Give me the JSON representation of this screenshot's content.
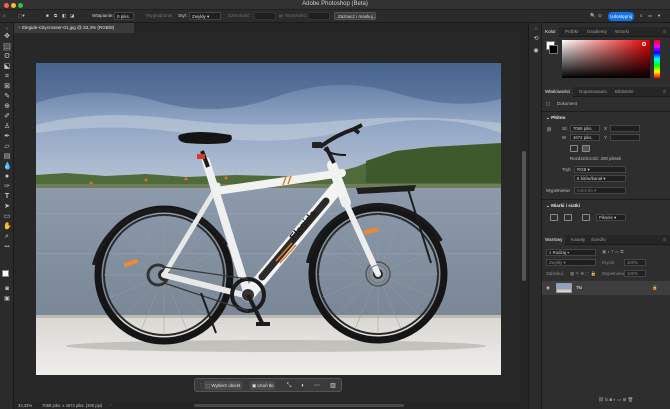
{
  "window": {
    "title": "Adobe Photoshop (Beta)"
  },
  "options_bar": {
    "feather_label": "Wtapianie:",
    "feather_value": "0 piks.",
    "antialias_label": "Wygładzanie",
    "style_label": "Styl:",
    "style_value": "Zwykły",
    "width_label": "Szerokość:",
    "height_label": "Wysokość:",
    "select_mask_label": "Zaznacz i maskuj...",
    "share_label": "Udostępnij"
  },
  "document": {
    "tab_title": "Elegide-Citycrosser-01.jpg @ 33,3% (RGB/8)",
    "brand_on_frame": "Elegida"
  },
  "status_bar": {
    "zoom": "33,33%",
    "doc_info": "7068 piks. x 4672 piks. (300 ppi)"
  },
  "context_bar": {
    "select_subject": "Wybierz obiekt",
    "remove_bg": "Usuń tło"
  },
  "color_panel": {
    "tabs": [
      "Kolor",
      "Próbki",
      "Gradienty",
      "Wzorki"
    ],
    "accent": "#e60000",
    "foreground": "#ffffff",
    "background": "#000000"
  },
  "properties_panel": {
    "tabs": [
      "Właściwości",
      "Dopasowania",
      "Biblioteki"
    ],
    "doc_label": "Dokument",
    "canvas_section": "Płótno",
    "w_label": "Sz",
    "w_value": "7068 piks.",
    "h_label": "W",
    "h_value": "4672 piks.",
    "x_label": "X",
    "y_label": "Y",
    "resolution": "Rozdzielczość: 300 pikseli",
    "mode_label": "Tryb",
    "mode_value": "RGB",
    "bit_value": "8 bitów/kanał",
    "fill_label": "Wypełnienie",
    "fill_value": "Kolor tła",
    "guides_section": "Miarki i siatki",
    "guides_select": "Piksele"
  },
  "layers_panel": {
    "tabs": [
      "Warstwy",
      "Kanały",
      "Ścieżki"
    ],
    "search_placeholder": "Rodzaj",
    "blend_mode": "Zwykły",
    "opacity_label": "Krycie:",
    "opacity_value": "100%",
    "lock_label": "Zablokuj:",
    "fill_label": "Wypełnienie:",
    "fill_value": "100%",
    "layer_name": "Tło"
  }
}
